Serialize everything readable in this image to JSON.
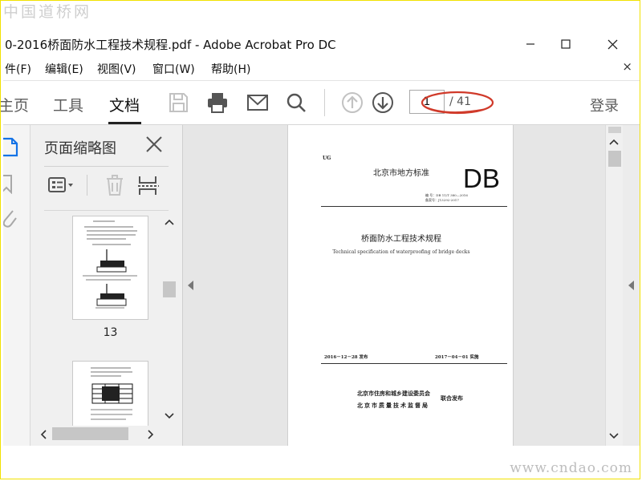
{
  "watermarks": {
    "top": "中国道桥网",
    "bottom": "www.cndao.com"
  },
  "window": {
    "title": "0-2016桥面防水工程技术规程.pdf - Adobe Acrobat Pro DC",
    "minimize_icon": "minimize-icon",
    "maximize_icon": "maximize-icon",
    "close_icon": "close-icon"
  },
  "menu": {
    "items": [
      "件(F)",
      "编辑(E)",
      "视图(V)",
      "窗口(W)",
      "帮助(H)"
    ],
    "close": "×"
  },
  "toolbar": {
    "tabs": [
      "主页",
      "工具",
      "文档"
    ],
    "active_tab": "文档",
    "icons": [
      "save-icon",
      "print-icon",
      "email-icon",
      "search-icon",
      "page-up-icon",
      "page-down-icon"
    ],
    "current_page": "1",
    "page_total": "/ 41",
    "annotation_color": "#d03a2a",
    "login": "登录"
  },
  "left_rail": {
    "icons": [
      "page-thumbnails-icon",
      "bookmark-icon",
      "attachment-icon"
    ],
    "active_color": "#1473e6"
  },
  "thumbnail_panel": {
    "title": "页面缩略图",
    "options_icon": "thumbnail-options-icon",
    "delete_icon": "delete-icon",
    "extract_icon": "extract-page-icon",
    "thumbnails": [
      {
        "page_number": "13"
      },
      {
        "page_number": ""
      }
    ]
  },
  "document_page": {
    "ug": "UG",
    "standard_type": "北京市地方标准",
    "db_mark": "DB",
    "codes": [
      "编    号：DB 11/T 380—2016",
      "备案号：J13292-2017"
    ],
    "cn_title": "桥面防水工程技术规程",
    "en_title": "Technical specification of waterproofing of bridge decks",
    "issue_date": "2016－12－28 发布",
    "implement_date": "2017－04－01 实施",
    "issuer_1": "北京市住房和城乡建设委员会",
    "issuer_2": "北京市质量技术监督局",
    "joint_issue": "联合发布"
  }
}
